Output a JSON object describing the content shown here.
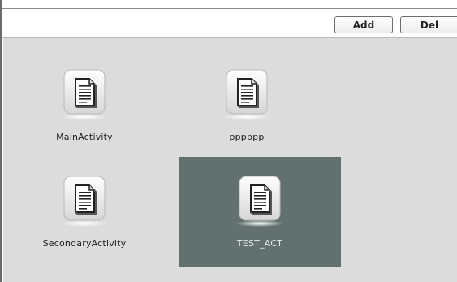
{
  "toolbar": {
    "add_label": "Add",
    "del_label": "Del"
  },
  "activities": [
    {
      "label": "MainActivity",
      "icon": "document-icon",
      "selected": false
    },
    {
      "label": "pppppp",
      "icon": "document-icon",
      "selected": false
    },
    {
      "label": "SecondaryActivity",
      "icon": "document-icon",
      "selected": false
    },
    {
      "label": "TEST_ACT",
      "icon": "document-icon",
      "selected": true
    }
  ],
  "colors": {
    "canvas_bg": "#dcdcdc",
    "selected_bg": "#627070"
  }
}
